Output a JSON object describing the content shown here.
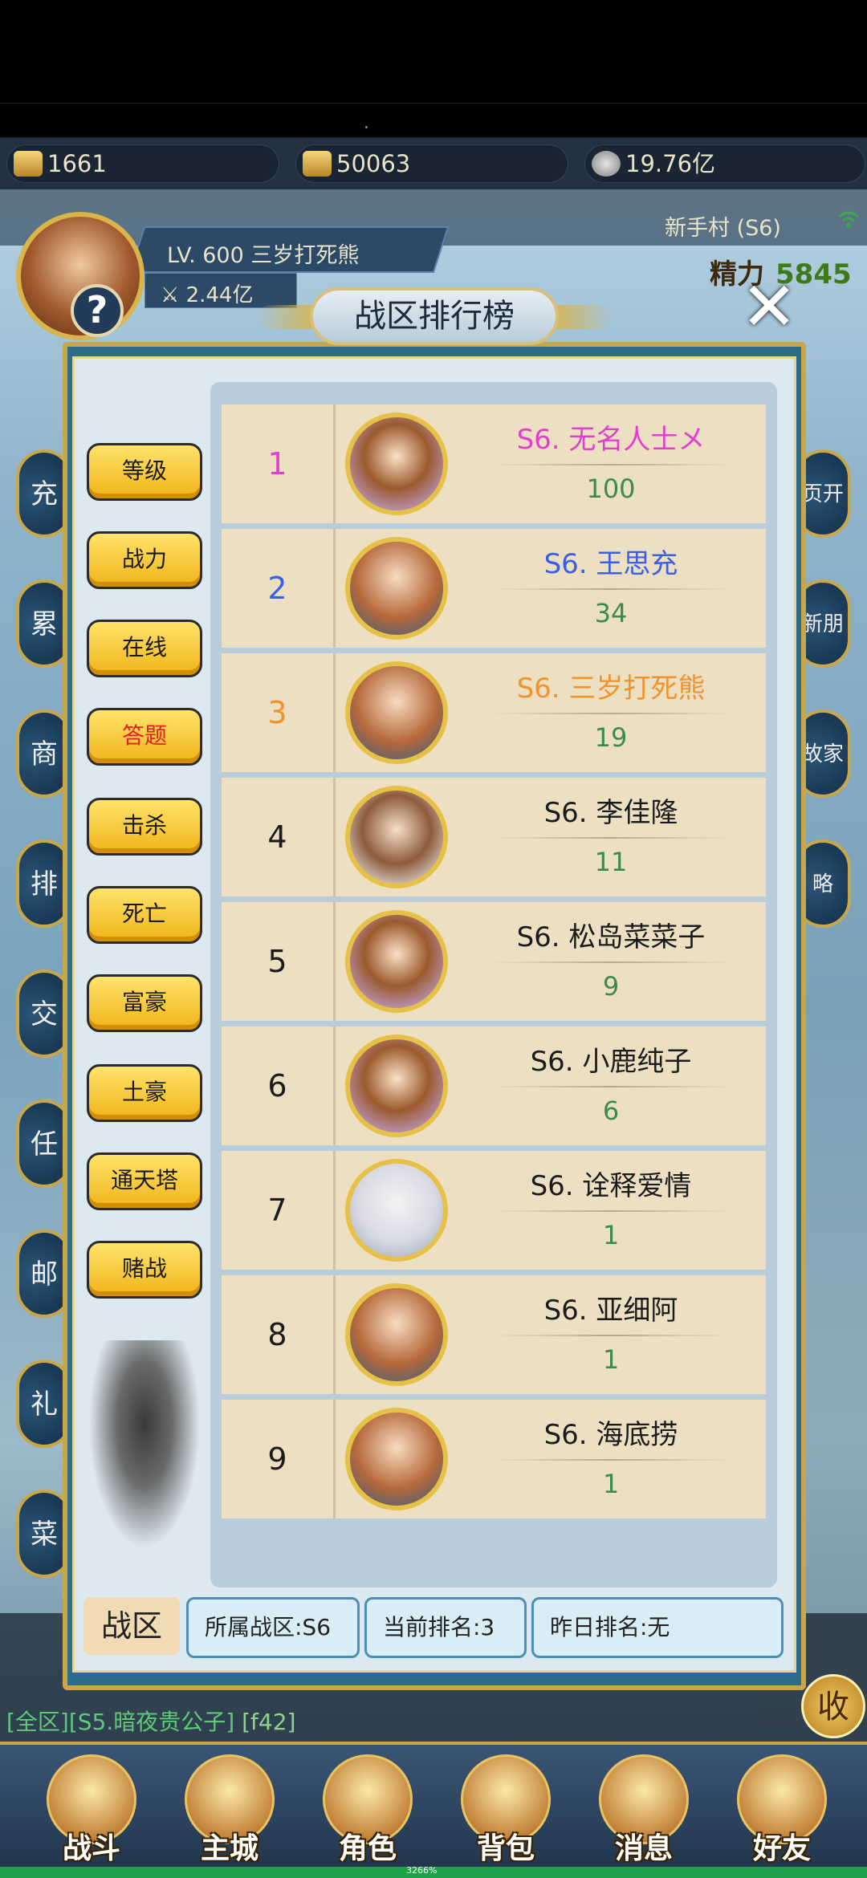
{
  "resources": {
    "gold": "1661",
    "ingot": "50063",
    "silver": "19.76亿"
  },
  "player": {
    "level_name": "LV. 600 三岁打死熊",
    "power": "2.44亿"
  },
  "location": "新手村 (S6)",
  "energy": {
    "label": "精力",
    "value": "5845"
  },
  "side_buttons_left": [
    "充",
    "累",
    "商",
    "排",
    "交",
    "任",
    "邮",
    "礼",
    "菜"
  ],
  "side_buttons_right": [
    "页开",
    "新朋",
    "故家",
    "略"
  ],
  "panel": {
    "title": "战区排行榜",
    "categories": [
      "等级",
      "战力",
      "在线",
      "答题",
      "击杀",
      "死亡",
      "富豪",
      "土豪",
      "通天塔",
      "赌战"
    ],
    "active_category": "答题",
    "rows": [
      {
        "rank": "1",
        "name": "S6. 无名人士メ",
        "score": "100",
        "color": "#e33fce",
        "avatar": "girl"
      },
      {
        "rank": "2",
        "name": "S6. 王思充",
        "score": "34",
        "color": "#3a5ee6",
        "avatar": "hero"
      },
      {
        "rank": "3",
        "name": "S6. 三岁打死熊",
        "score": "19",
        "color": "#f0932a",
        "avatar": "hero"
      },
      {
        "rank": "4",
        "name": "S6. 李佳隆",
        "score": "11",
        "color": "#1b1b1b",
        "avatar": "boy"
      },
      {
        "rank": "5",
        "name": "S6. 松岛菜菜子",
        "score": "9",
        "color": "#1b1b1b",
        "avatar": "girl"
      },
      {
        "rank": "6",
        "name": "S6. 小鹿纯子",
        "score": "6",
        "color": "#1b1b1b",
        "avatar": "girl"
      },
      {
        "rank": "7",
        "name": "S6. 诠释爱情",
        "score": "1",
        "color": "#1b1b1b",
        "avatar": "white"
      },
      {
        "rank": "8",
        "name": "S6. 亚细阿",
        "score": "1",
        "color": "#1b1b1b",
        "avatar": "hero"
      },
      {
        "rank": "9",
        "name": "S6. 海底捞",
        "score": "1",
        "color": "#1b1b1b",
        "avatar": "hero"
      }
    ],
    "footer": {
      "tab": "战区",
      "zone": "所属战区:S6",
      "current_rank": "当前排名:3",
      "yesterday_rank": "昨日排名:无"
    }
  },
  "chat": {
    "channel": "[全区]",
    "sender": "[S5.暗夜贵公子]",
    "msg": "[f42]"
  },
  "collapse_label": "收",
  "nav": [
    "战斗",
    "主城",
    "角色",
    "背包",
    "消息",
    "好友"
  ],
  "progress_text": "3266%"
}
